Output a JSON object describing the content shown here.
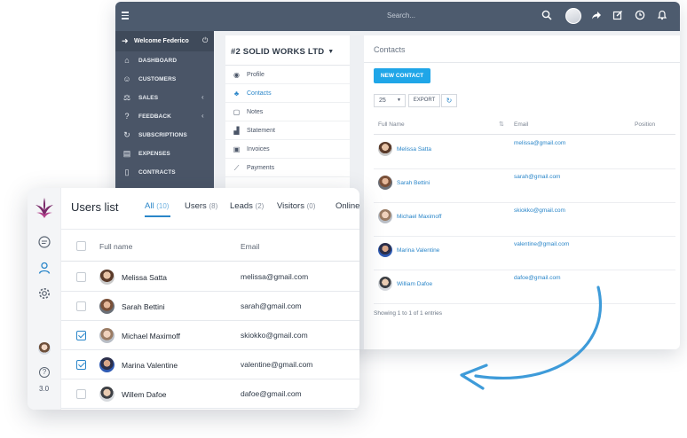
{
  "crm": {
    "topbar": {
      "search_placeholder": "Search..."
    },
    "sidebar": {
      "welcome": "Welcome Federico",
      "items": [
        {
          "label": "DASHBOARD",
          "icon": "home-icon",
          "has_chevron": false
        },
        {
          "label": "CUSTOMERS",
          "icon": "user-icon",
          "has_chevron": false
        },
        {
          "label": "SALES",
          "icon": "balance-icon",
          "has_chevron": true
        },
        {
          "label": "FEEDBACK",
          "icon": "question-icon",
          "has_chevron": true
        },
        {
          "label": "SUBSCRIPTIONS",
          "icon": "refresh-icon",
          "has_chevron": false
        },
        {
          "label": "EXPENSES",
          "icon": "document-icon",
          "has_chevron": false
        },
        {
          "label": "CONTRACTS",
          "icon": "file-icon",
          "has_chevron": false
        }
      ]
    },
    "subnav": {
      "company": "#2 SOLID WORKS LTD",
      "items": [
        {
          "label": "Profile",
          "icon": "profile-icon",
          "active": false
        },
        {
          "label": "Contacts",
          "icon": "users-icon",
          "active": true
        },
        {
          "label": "Notes",
          "icon": "notes-icon",
          "active": false
        },
        {
          "label": "Statement",
          "icon": "chart-icon",
          "active": false
        },
        {
          "label": "Invoices",
          "icon": "invoice-icon",
          "active": false
        },
        {
          "label": "Payments",
          "icon": "line-chart-icon",
          "active": false
        }
      ]
    },
    "contacts": {
      "title": "Contacts",
      "new_button": "NEW CONTACT",
      "page_size": "25",
      "export_button": "EXPORT",
      "columns": {
        "full_name": "Full Name",
        "email": "Email",
        "position": "Position"
      },
      "rows": [
        {
          "name": "Melissa Satta",
          "email": "melissa@gmail.com"
        },
        {
          "name": "Sarah Bettini",
          "email": "sarah@gmail.com"
        },
        {
          "name": "Michael Maximoff",
          "email": "skiokko@gmail.com"
        },
        {
          "name": "Marina Valentine",
          "email": "valentine@gmail.com"
        },
        {
          "name": "William Dafoe",
          "email": "dafoe@gmail.com"
        }
      ],
      "showing": "Showing 1 to 1 of 1 entries"
    }
  },
  "users": {
    "title": "Users list",
    "tabs": [
      {
        "label": "All",
        "count": "(10)",
        "active": true
      },
      {
        "label": "Users",
        "count": "(8)",
        "active": false
      },
      {
        "label": "Leads",
        "count": "(2)",
        "active": false
      },
      {
        "label": "Visitors",
        "count": "(0)",
        "active": false
      },
      {
        "label": "Online",
        "count": "",
        "active": false
      }
    ],
    "columns": {
      "full_name": "Full name",
      "email": "Email"
    },
    "rows": [
      {
        "name": "Melissa Satta",
        "email": "melissa@gmail.com",
        "checked": false
      },
      {
        "name": "Sarah Bettini",
        "email": "sarah@gmail.com",
        "checked": false
      },
      {
        "name": "Michael Maximoff",
        "email": "skiokko@gmail.com",
        "checked": true
      },
      {
        "name": "Marina Valentine",
        "email": "valentine@gmail.com",
        "checked": true
      },
      {
        "name": "Willem Dafoe",
        "email": "dafoe@gmail.com",
        "checked": false
      }
    ],
    "help_symbol": "?",
    "version": "3.0"
  },
  "colors": {
    "accent": "#2a86c9",
    "sidebar": "#4a5567",
    "topbar": "#4d5b6e",
    "button": "#1fa6e8",
    "arrow": "#3e9bd9"
  }
}
